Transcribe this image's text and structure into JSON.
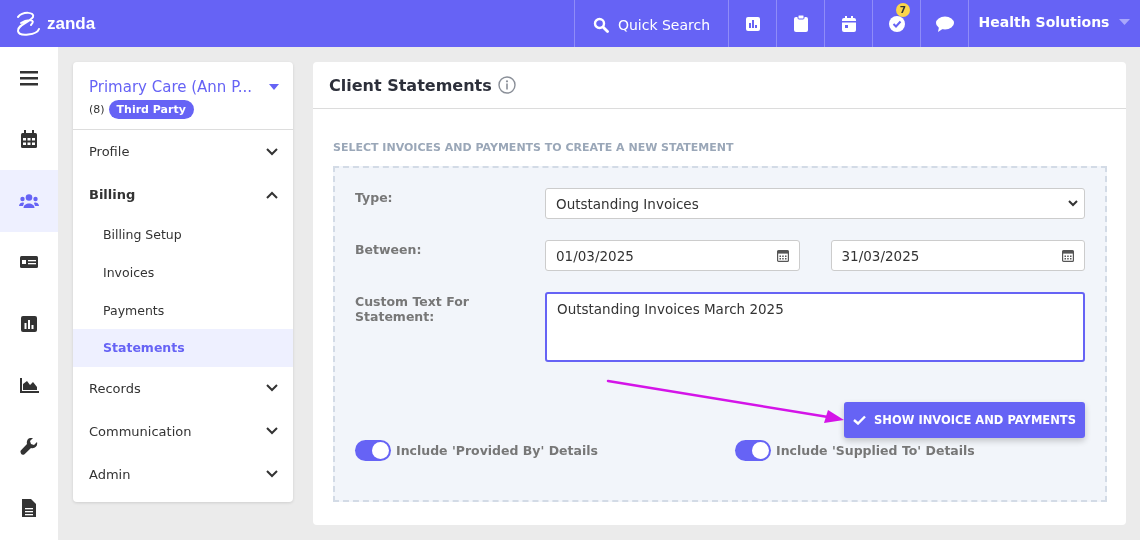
{
  "topbar": {
    "logo": "zanda",
    "quick_search": "Quick Search",
    "icons": [
      {
        "kind": "chart"
      },
      {
        "kind": "clipboard"
      },
      {
        "kind": "calendar"
      },
      {
        "kind": "check",
        "badge": "7"
      },
      {
        "kind": "chat"
      }
    ],
    "account": "Health Solutions"
  },
  "rail": [
    {
      "kind": "menu",
      "selected": false
    },
    {
      "kind": "calendar",
      "selected": false
    },
    {
      "kind": "users",
      "selected": true
    },
    {
      "kind": "card",
      "selected": false
    },
    {
      "kind": "chart",
      "selected": false
    },
    {
      "kind": "area",
      "selected": false
    },
    {
      "kind": "wrench",
      "selected": false
    },
    {
      "kind": "document",
      "selected": false
    }
  ],
  "client": {
    "name": "Primary Care (Ann P...",
    "count": "(8)",
    "tag": "Third Party"
  },
  "nav": [
    {
      "label": "Profile",
      "expanded": false
    },
    {
      "label": "Billing",
      "expanded": true,
      "children": [
        {
          "label": "Billing Setup",
          "selected": false
        },
        {
          "label": "Invoices",
          "selected": false
        },
        {
          "label": "Payments",
          "selected": false
        },
        {
          "label": "Statements",
          "selected": true
        }
      ]
    },
    {
      "label": "Records",
      "expanded": false
    },
    {
      "label": "Communication",
      "expanded": false
    },
    {
      "label": "Admin",
      "expanded": false
    }
  ],
  "panel": {
    "title": "Client Statements",
    "section": "SELECT INVOICES AND PAYMENTS TO CREATE A NEW STATEMENT",
    "type_label": "Type:",
    "type_value": "Outstanding Invoices",
    "between_label": "Between:",
    "date_from": "01/03/2025",
    "date_to": "31/03/2025",
    "custom_label": "Custom Text For Statement:",
    "custom_value": "Outstanding Invoices March 2025",
    "button": "SHOW INVOICE AND PAYMENTS",
    "toggles": [
      {
        "label": "Include 'Provided By' Details",
        "on": true
      },
      {
        "label": "Include 'Supplied To' Details",
        "on": true
      }
    ]
  }
}
